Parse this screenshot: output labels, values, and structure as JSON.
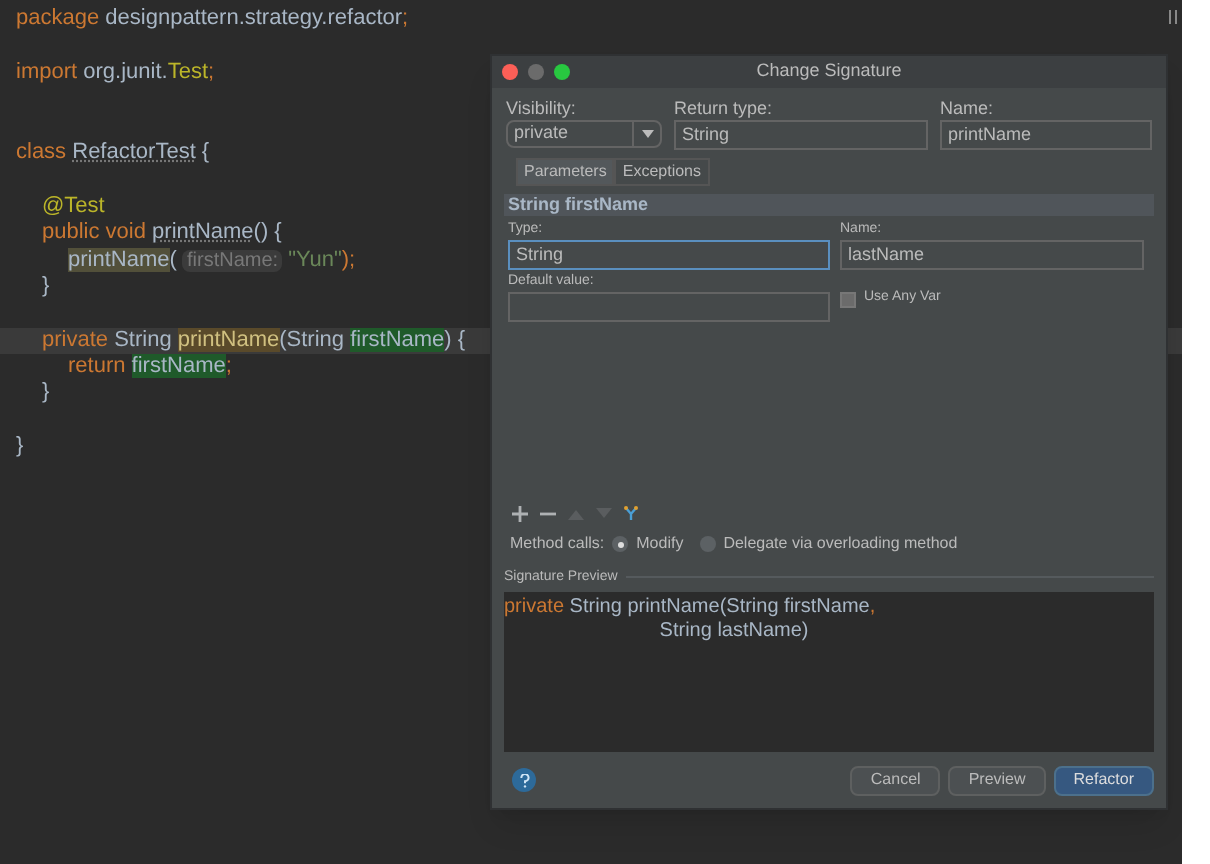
{
  "editor": {
    "lines": [
      {
        "kind": "code",
        "current": false,
        "tokens": [
          {
            "text": "package ",
            "kind": "keyword"
          },
          {
            "text": "designpattern.strategy.refactor",
            "kind": "plain"
          },
          {
            "text": ";",
            "kind": "keyword"
          }
        ]
      },
      {
        "kind": "blank"
      },
      {
        "kind": "code",
        "current": false,
        "tokens": [
          {
            "text": "import ",
            "kind": "keyword"
          },
          {
            "text": "org.junit.",
            "kind": "plain"
          },
          {
            "text": "Test",
            "kind": "annotation"
          },
          {
            "text": ";",
            "kind": "keyword"
          }
        ]
      },
      {
        "kind": "blank"
      },
      {
        "kind": "blank"
      },
      {
        "kind": "code",
        "current": false,
        "tokens": [
          {
            "text": "class ",
            "kind": "keyword"
          },
          {
            "text": "RefactorTest",
            "kind": "unused"
          },
          {
            "text": " {",
            "kind": "plain"
          }
        ],
        "children": [
          {
            "kind": "blank"
          },
          {
            "kind": "code",
            "current": false,
            "tokens": [
              {
                "text": "@Test",
                "kind": "annotation"
              }
            ]
          },
          {
            "kind": "code",
            "current": false,
            "tokens": [
              {
                "text": "public void ",
                "kind": "keyword"
              },
              {
                "text": "printName",
                "kind": "unused"
              },
              {
                "text": "() {",
                "kind": "plain"
              }
            ],
            "children": [
              {
                "kind": "code",
                "current": false,
                "tokens": [
                  {
                    "text": "printName",
                    "kind": "usage"
                  },
                  {
                    "text": "( ",
                    "kind": "plain"
                  },
                  {
                    "text": "firstName:",
                    "kind": "hint"
                  },
                  {
                    "text": " \"Yun\"",
                    "kind": "string"
                  },
                  {
                    "text": ");",
                    "kind": "keyword"
                  }
                ]
              }
            ]
          },
          {
            "kind": "code",
            "current": false,
            "tokens": [
              {
                "text": "}",
                "kind": "plain"
              }
            ]
          },
          {
            "kind": "blank"
          },
          {
            "kind": "code",
            "current": true,
            "tokens": [
              {
                "text": "private ",
                "kind": "keyword"
              },
              {
                "text": "String ",
                "kind": "plain"
              },
              {
                "text": "printName",
                "kind": "declaration"
              },
              {
                "text": "(String ",
                "kind": "plain"
              },
              {
                "text": "firstName",
                "kind": "write"
              },
              {
                "text": ") {",
                "kind": "plain"
              }
            ],
            "children": [
              {
                "kind": "code",
                "current": false,
                "tokens": [
                  {
                    "text": "return ",
                    "kind": "keyword"
                  },
                  {
                    "text": "firstName",
                    "kind": "write"
                  },
                  {
                    "text": ";",
                    "kind": "keyword"
                  }
                ]
              }
            ]
          },
          {
            "kind": "code",
            "current": false,
            "tokens": [
              {
                "text": "}",
                "kind": "plain"
              }
            ]
          }
        ]
      },
      {
        "kind": "blank"
      },
      {
        "kind": "code",
        "current": false,
        "tokens": [
          {
            "text": "}",
            "kind": "plain"
          }
        ]
      }
    ]
  },
  "dialog": {
    "title": "Change Signature",
    "visibility": {
      "label": "Visibility:",
      "value": "private"
    },
    "return_type": {
      "label": "Return type:",
      "value": "String"
    },
    "name": {
      "label": "Name:",
      "value": "printName"
    },
    "tabs": [
      {
        "label": "Parameters",
        "selected": true
      },
      {
        "label": "Exceptions",
        "selected": false
      }
    ],
    "parameter_header": "String firstName",
    "type": {
      "label": "Type:",
      "value": "String",
      "focused": true
    },
    "param_name": {
      "label": "Name:",
      "value": "lastName",
      "focused": false
    },
    "default_value": {
      "label": "Default value:"
    },
    "use_any_var": {
      "label": "Use Any Var",
      "checked": false
    },
    "toolbar": [
      {
        "kind": "add",
        "disabled": false
      },
      {
        "kind": "remove",
        "disabled": false
      },
      {
        "kind": "up",
        "disabled": true
      },
      {
        "kind": "down",
        "disabled": true
      },
      {
        "kind": "propagate",
        "disabled": false
      }
    ],
    "method_calls": {
      "label": "Method calls:",
      "options": [
        {
          "label": "Modify",
          "selected": true
        },
        {
          "label": "Delegate via overloading method",
          "selected": false
        }
      ]
    },
    "preview": {
      "label": "Signature Preview",
      "lines": [
        {
          "tokens": [
            {
              "text": "private ",
              "kind": "keyword"
            },
            {
              "text": "String printName(String firstName",
              "kind": "plain"
            },
            {
              "text": ",",
              "kind": "keyword"
            }
          ]
        },
        {
          "tokens": [
            {
              "text": "                            String lastName)",
              "kind": "plain"
            }
          ]
        }
      ]
    },
    "buttons": [
      {
        "label": "Cancel",
        "default": false
      },
      {
        "label": "Preview",
        "default": false
      },
      {
        "label": "Refactor",
        "default": true
      }
    ]
  }
}
